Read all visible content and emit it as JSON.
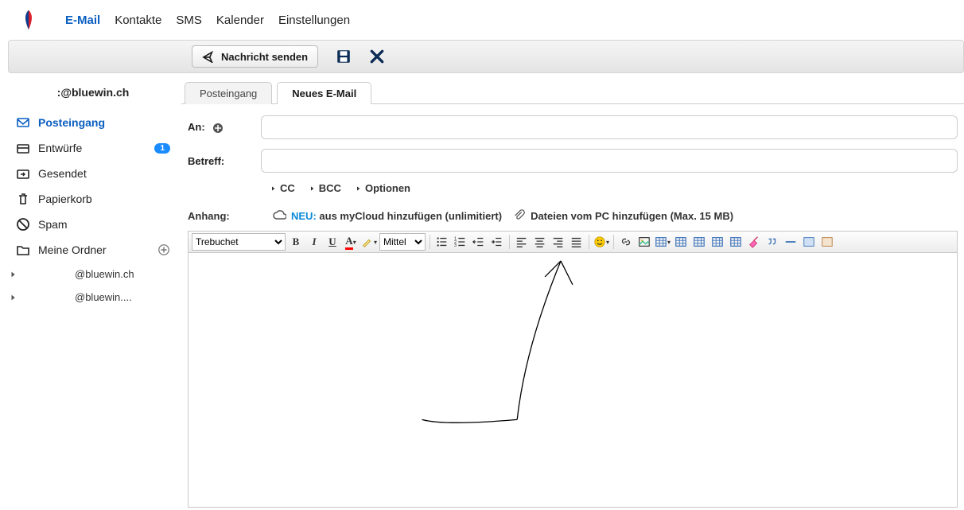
{
  "nav": {
    "email": "E-Mail",
    "contacts": "Kontakte",
    "sms": "SMS",
    "calendar": "Kalender",
    "settings": "Einstellungen"
  },
  "actionbar": {
    "send": "Nachricht senden"
  },
  "sidebar": {
    "account": ":@bluewin.ch",
    "inbox": "Posteingang",
    "drafts": "Entwürfe",
    "drafts_count": "1",
    "sent": "Gesendet",
    "trash": "Papierkorb",
    "spam": "Spam",
    "myfolders": "Meine Ordner",
    "sub1": "@bluewin.ch",
    "sub2": "@bluewin...."
  },
  "tabs": {
    "inbox": "Posteingang",
    "newmail": "Neues E-Mail"
  },
  "compose": {
    "to_label": "An:",
    "subject_label": "Betreff:",
    "cc": "CC",
    "bcc": "BCC",
    "options": "Optionen",
    "attach_label": "Anhang:",
    "cloud_neu": "NEU:",
    "cloud_text": " aus myCloud hinzufügen (unlimitiert)",
    "pc_text": "Dateien vom PC hinzufügen (Max. 15 MB)"
  },
  "editor": {
    "font": "Trebuchet",
    "size": "Mittel"
  }
}
